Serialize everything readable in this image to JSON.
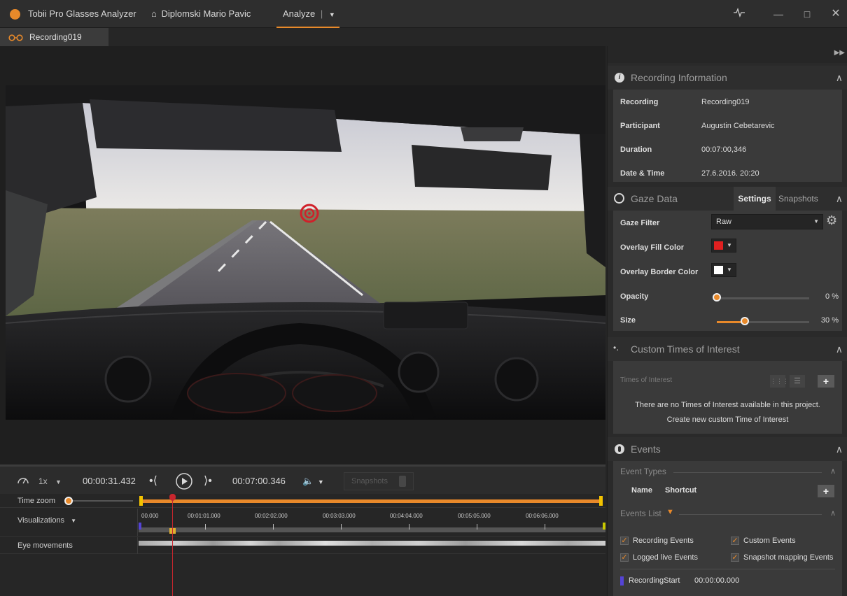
{
  "titlebar": {
    "app_name": "Tobii Pro Glasses Analyzer",
    "project": "Diplomski Mario Pavic",
    "analyze_tab": "Analyze"
  },
  "recording_tab": {
    "label": "Recording019"
  },
  "controls": {
    "speed": "1x",
    "current_time": "00:00:31.432",
    "total_time": "00:07:00.346",
    "snapshots_label": "Snapshots"
  },
  "timeline": {
    "time_zoom_label": "Time zoom",
    "visualizations_label": "Visualizations",
    "eye_movements_label": "Eye movements",
    "ticks": [
      "00.000",
      "00:01:01.000",
      "00:02:02.000",
      "00:03:03.000",
      "00:04:04.000",
      "00:05:05.000",
      "00:06:06.000"
    ]
  },
  "recording_info": {
    "title": "Recording Information",
    "rows": [
      {
        "label": "Recording",
        "value": "Recording019"
      },
      {
        "label": "Participant",
        "value": "Augustin Cebetarevic"
      },
      {
        "label": "Duration",
        "value": "00:07:00,346"
      },
      {
        "label": "Date & Time",
        "value": "27.6.2016. 20:20"
      }
    ]
  },
  "gaze_data": {
    "title": "Gaze Data",
    "tab_settings": "Settings",
    "tab_snapshots": "Snapshots",
    "gaze_filter_label": "Gaze Filter",
    "gaze_filter_value": "Raw",
    "fill_color_label": "Overlay Fill Color",
    "fill_color": "#e02020",
    "border_color_label": "Overlay Border Color",
    "border_color": "#ffffff",
    "opacity_label": "Opacity",
    "opacity_value": "0 %",
    "size_label": "Size",
    "size_value": "30 %"
  },
  "custom_toi": {
    "title": "Custom Times of Interest",
    "subheader": "Times of Interest",
    "empty_msg": "There are no Times of Interest available in this project.",
    "create_link": "Create new custom Time of Interest"
  },
  "events": {
    "title": "Events",
    "event_types_label": "Event Types",
    "col_name": "Name",
    "col_shortcut": "Shortcut",
    "events_list_label": "Events List",
    "checkboxes": [
      "Recording Events",
      "Custom Events",
      "Logged live Events",
      "Snapshot mapping Events"
    ],
    "first_event_name": "RecordingStart",
    "first_event_time": "00:00:00.000"
  },
  "colors": {
    "accent": "#e8892a",
    "gaze_marker": "#d0202a"
  }
}
